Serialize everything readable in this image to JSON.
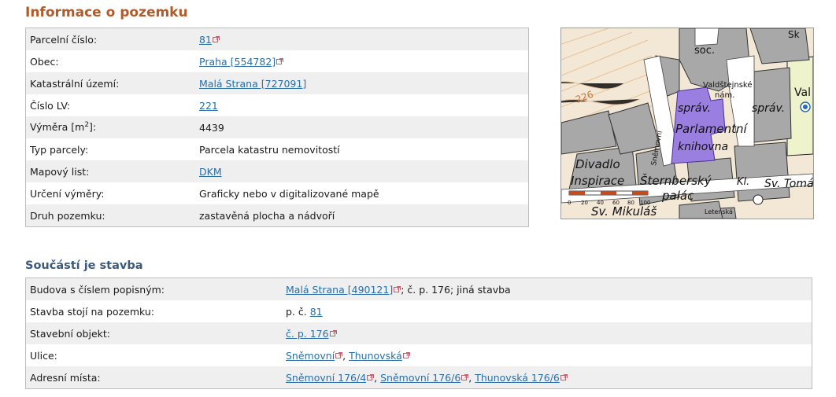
{
  "section1": {
    "title": "Informace o pozemku",
    "rows": [
      {
        "label": "Parcelní číslo:",
        "link": "81"
      },
      {
        "label": "Obec:",
        "link": "Praha [554782]"
      },
      {
        "label": "Katastrální území:",
        "link": "Malá Strana [727091]"
      },
      {
        "label": "Číslo LV:",
        "link": "221"
      },
      {
        "label_pre": "Výměra [m",
        "label_sup": "2",
        "label_post": "]:",
        "value": "4439"
      },
      {
        "label": "Typ parcely:",
        "value": "Parcela katastru nemovitostí"
      },
      {
        "label": "Mapový list:",
        "link": "DKM"
      },
      {
        "label": "Určení výměry:",
        "value": "Graficky nebo v digitalizované mapě"
      },
      {
        "label": "Druh pozemku:",
        "value": "zastavěná plocha a nádvoří"
      }
    ]
  },
  "map": {
    "labels": [
      "soc.",
      "Valdštejnské",
      "nám.",
      "správ.",
      "správ.",
      "Parlamentní",
      "knihovna",
      "Divadlo",
      "Inspirace",
      "Šternberský",
      "palác",
      "Kl.",
      "Sv. Tomáš",
      "Sv. Mikuláš",
      "Val",
      "Sk",
      "Sněmovní",
      "226",
      "Letenská"
    ],
    "scale_labels": [
      "0",
      "20",
      "40",
      "60",
      "80",
      "100"
    ],
    "colors": {
      "parcel": "#9b7fe0",
      "building": "#a9a9a9",
      "street": "#ffffff",
      "garden": "#f2d9b4",
      "yard": "#eaf2c8"
    }
  },
  "section2": {
    "title": "Součástí je stavba",
    "rows": [
      {
        "label": "Budova s číslem popisným:",
        "link": "Malá Strana [490121]",
        "after": "; č. p. 176; jiná stavba"
      },
      {
        "label": "Stavba stojí na pozemku:",
        "prefix": "p. č. ",
        "link": "81"
      },
      {
        "label": "Stavební objekt:",
        "link": "č. p. 176"
      },
      {
        "label": "Ulice:",
        "link": "Sněmovní",
        "sep": ", ",
        "link2": "Thunovská"
      },
      {
        "label": "Adresní místa:",
        "link": "Sněmovní 176/4",
        "sep": ", ",
        "link2": "Sněmovní 176/6",
        "sep2": ", ",
        "link3": "Thunovská 176/6"
      }
    ]
  }
}
